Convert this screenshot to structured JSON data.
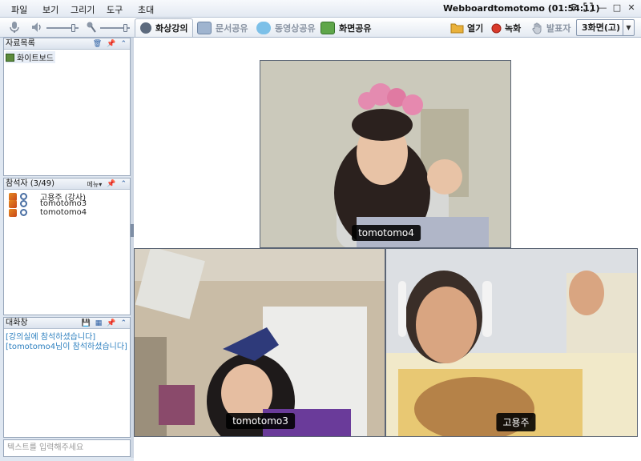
{
  "menu": {
    "items": [
      "파일",
      "보기",
      "그리기",
      "도구",
      "초대"
    ],
    "title": "Webboardtomotomo (01:54:11)"
  },
  "toolbar": {
    "tabs": [
      "화상강의",
      "문서공유",
      "동영상공유",
      "화면공유"
    ],
    "open_label": "열기",
    "record_label": "녹화",
    "presenter_label": "발표자",
    "layout_value": "3화면(고)"
  },
  "files_panel": {
    "title": "자료목록",
    "items": [
      "화이트보드"
    ]
  },
  "participants_panel": {
    "title": "참석자 (3/49)",
    "menu_label": "메뉴",
    "items": [
      "고용주 (강사)",
      "tomotomo3",
      "tomotomo4"
    ]
  },
  "chat_panel": {
    "title": "대화창",
    "messages": [
      "[강의실에 참석하셨습니다]",
      "[tomotomo4님이 참석하셨습니다]"
    ],
    "input_placeholder": "텍스트를 입력해주세요"
  },
  "videos": [
    {
      "name": "tomotomo4"
    },
    {
      "name": "tomotomo3"
    },
    {
      "name": "고용주"
    }
  ],
  "colors": {
    "chat_text": "#2c7fbf",
    "record_dot": "#d93a2b",
    "open_folder": "#e9b13b"
  }
}
